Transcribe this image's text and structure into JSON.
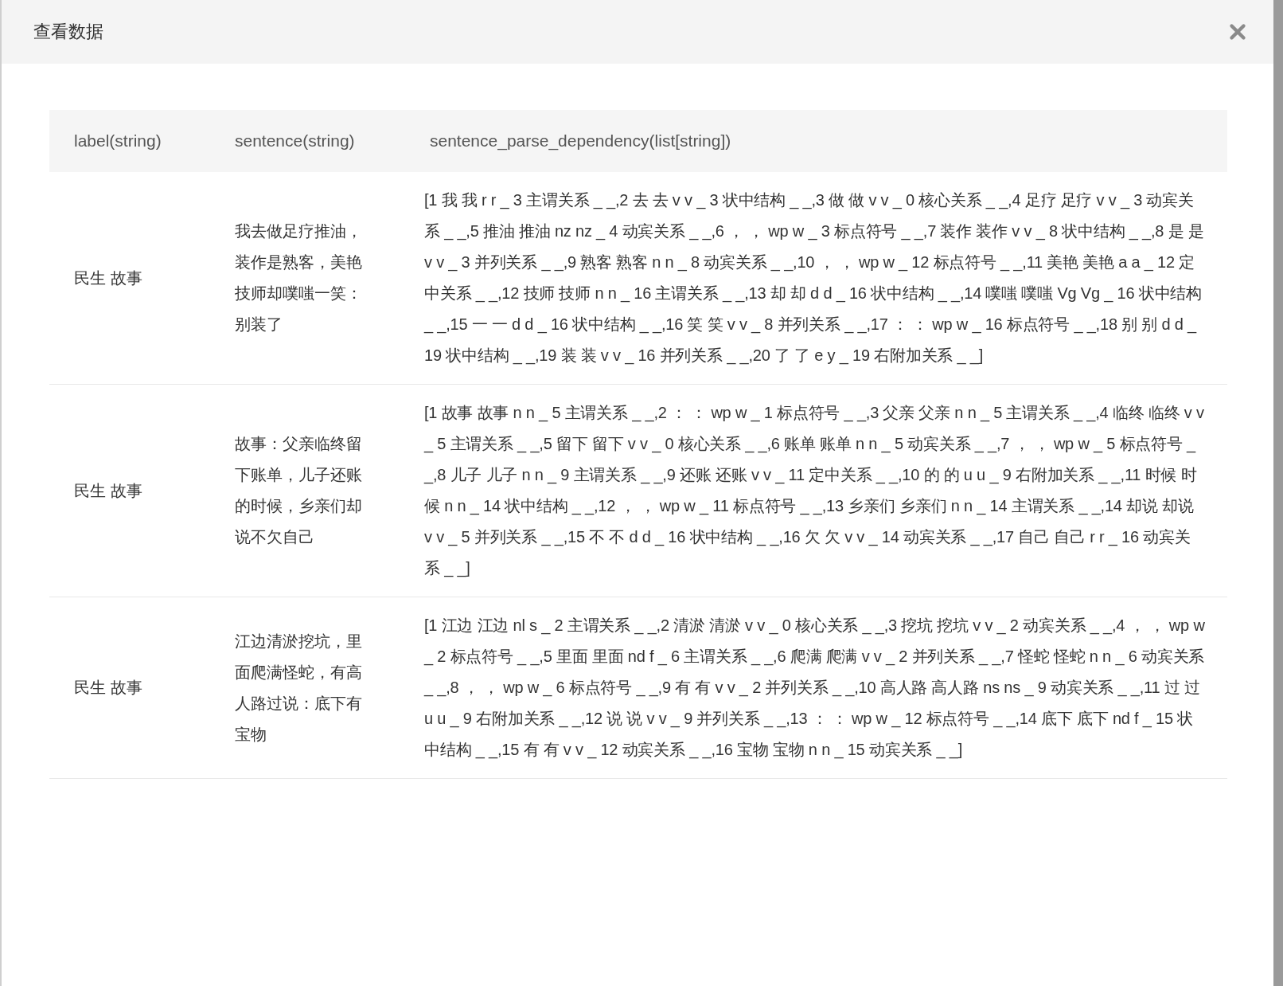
{
  "dialog": {
    "title": "查看数据"
  },
  "table": {
    "columns": [
      "label(string)",
      "sentence(string)",
      "sentence_parse_dependency(list[string])"
    ],
    "rows": [
      {
        "label": "民生 故事",
        "sentence": "我去做足疗推油，装作是熟客，美艳技师却噗嗤一笑：别装了",
        "parse": "[1 我 我 r r _ 3 主谓关系 _ _,2 去 去 v v _ 3 状中结构 _ _,3 做 做 v v _ 0 核心关系 _ _,4 足疗 足疗 v v _ 3 动宾关系 _ _,5 推油 推油 nz nz _ 4 动宾关系 _ _,6 ， ， wp w _ 3 标点符号 _ _,7 装作 装作 v v _ 8 状中结构 _ _,8 是 是 v v _ 3 并列关系 _ _,9 熟客 熟客 n n _ 8 动宾关系 _ _,10 ， ， wp w _ 12 标点符号 _ _,11 美艳 美艳 a a _ 12 定中关系 _ _,12 技师 技师 n n _ 16 主谓关系 _ _,13 却 却 d d _ 16 状中结构 _ _,14 噗嗤 噗嗤 Vg Vg _ 16 状中结构 _ _,15 一 一 d d _ 16 状中结构 _ _,16 笑 笑 v v _ 8 并列关系 _ _,17 ： ： wp w _ 16 标点符号 _ _,18 别 别 d d _ 19 状中结构 _ _,19 装 装 v v _ 16 并列关系 _ _,20 了 了 e y _ 19 右附加关系 _ _]"
      },
      {
        "label": "民生 故事",
        "sentence": "故事：父亲临终留下账单，儿子还账的时候，乡亲们却说不欠自己",
        "parse": "[1 故事 故事 n n _ 5 主谓关系 _ _,2 ： ： wp w _ 1 标点符号 _ _,3 父亲 父亲 n n _ 5 主谓关系 _ _,4 临终 临终 v v _ 5 主谓关系 _ _,5 留下 留下 v v _ 0 核心关系 _ _,6 账单 账单 n n _ 5 动宾关系 _ _,7 ， ， wp w _ 5 标点符号 _ _,8 儿子 儿子 n n _ 9 主谓关系 _ _,9 还账 还账 v v _ 11 定中关系 _ _,10 的 的 u u _ 9 右附加关系 _ _,11 时候 时候 n n _ 14 状中结构 _ _,12 ， ， wp w _ 11 标点符号 _ _,13 乡亲们 乡亲们 n n _ 14 主谓关系 _ _,14 却说 却说 v v _ 5 并列关系 _ _,15 不 不 d d _ 16 状中结构 _ _,16 欠 欠 v v _ 14 动宾关系 _ _,17 自己 自己 r r _ 16 动宾关系 _ _]"
      },
      {
        "label": "民生 故事",
        "sentence": "江边清淤挖坑，里面爬满怪蛇，有高人路过说：底下有宝物",
        "parse": "[1 江边 江边 nl s _ 2 主谓关系 _ _,2 清淤 清淤 v v _ 0 核心关系 _ _,3 挖坑 挖坑 v v _ 2 动宾关系 _ _,4 ， ， wp w _ 2 标点符号 _ _,5 里面 里面 nd f _ 6 主谓关系 _ _,6 爬满 爬满 v v _ 2 并列关系 _ _,7 怪蛇 怪蛇 n n _ 6 动宾关系 _ _,8 ， ， wp w _ 6 标点符号 _ _,9 有 有 v v _ 2 并列关系 _ _,10 高人路 高人路 ns ns _ 9 动宾关系 _ _,11 过 过 u u _ 9 右附加关系 _ _,12 说 说 v v _ 9 并列关系 _ _,13 ： ： wp w _ 12 标点符号 _ _,14 底下 底下 nd f _ 15 状中结构 _ _,15 有 有 v v _ 12 动宾关系 _ _,16 宝物 宝物 n n _ 15 动宾关系 _ _]"
      }
    ]
  }
}
